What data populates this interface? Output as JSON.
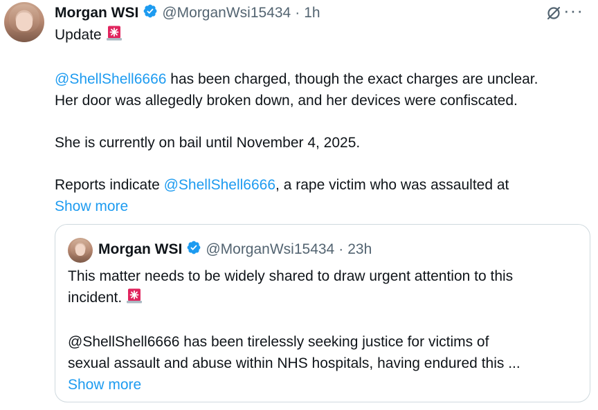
{
  "tweet": {
    "author_name": "Morgan WSI",
    "handle": "@MorganWsi15434",
    "separator": "·",
    "time": "1h",
    "line1_text": "Update",
    "para1_mention": "@ShellShell6666",
    "para1_text": " has been charged, though the exact charges are unclear.",
    "para1_line2": "Her door was allegedly broken down, and her devices were confiscated.",
    "para2": "She is currently on bail until November 4, 2025.",
    "para3_prefix": "Reports indicate ",
    "para3_mention": "@ShellShell6666",
    "para3_suffix": ", a rape victim who was assaulted at",
    "show_more": "Show more",
    "more_icon": "···"
  },
  "quote": {
    "author_name": "Morgan WSI",
    "handle": "@MorganWsi15434",
    "separator": "·",
    "time": "23h",
    "line1": "This matter needs to be widely shared to draw urgent attention to this",
    "line2_text": "incident.",
    "para2_line1": "@ShellShell6666 has been tirelessly seeking justice for victims of",
    "para2_line2": "sexual assault and abuse within NHS hospitals, having endured this ...",
    "show_more": "Show more"
  },
  "colors": {
    "link": "#1d9bf0",
    "muted": "#536471",
    "text": "#0f1419",
    "siren": "#e0245e",
    "border": "#cfd9de"
  },
  "icons": [
    "verified-badge-icon",
    "siren-emoji-icon",
    "grok-icon",
    "more-options-icon"
  ]
}
